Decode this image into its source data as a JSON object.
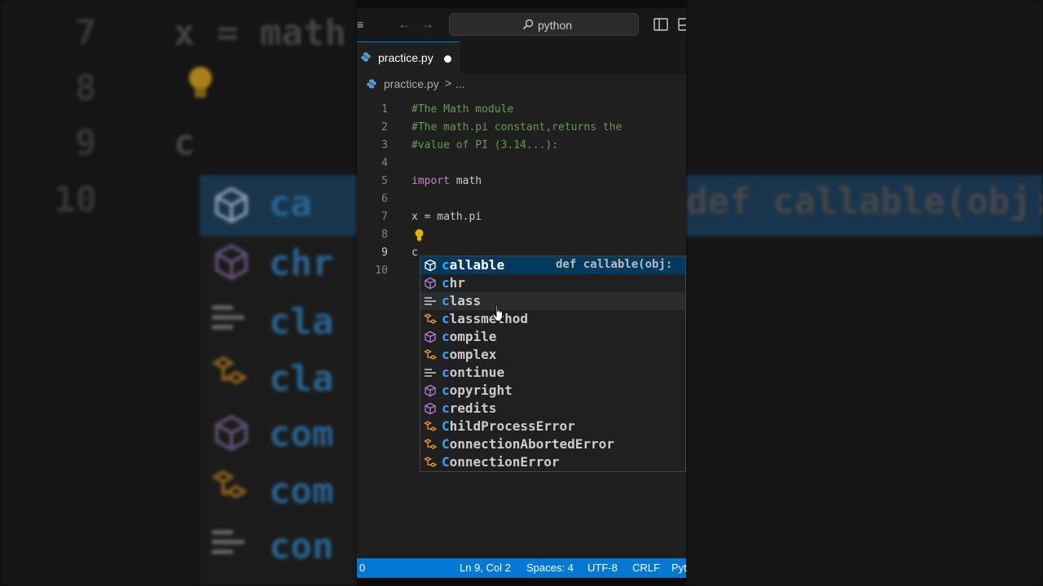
{
  "background": {
    "line_numbers": [
      "7",
      "8",
      "9",
      "10"
    ],
    "code_7": "x = math",
    "code_9": "c",
    "suggest_left": [
      "ca",
      "chr",
      "cla",
      "cla",
      "com",
      "com",
      "con"
    ],
    "suggest_right": "def callable(obj:"
  },
  "titlebar": {
    "search_text": "python"
  },
  "tab": {
    "label": "practice.py"
  },
  "breadcrumb": {
    "file": "practice.py",
    "separator": ">",
    "more": "..."
  },
  "editor": {
    "lines": [
      {
        "n": "1",
        "text": "#The Math module"
      },
      {
        "n": "2",
        "text": "#The math.pi constant,returns the"
      },
      {
        "n": "3",
        "text": "#value of PI (3.14...):"
      },
      {
        "n": "4",
        "text": ""
      },
      {
        "n": "5",
        "kw": "import",
        "rest": " math"
      },
      {
        "n": "6",
        "text": ""
      },
      {
        "n": "7",
        "text": "x = math.pi"
      },
      {
        "n": "8",
        "text": ""
      },
      {
        "n": "9",
        "text": "c"
      },
      {
        "n": "10",
        "text": ""
      }
    ]
  },
  "suggest": {
    "items": [
      {
        "first": "c",
        "rest": "allable",
        "icon": "variable-cube-icon",
        "detail": "def callable(obj:"
      },
      {
        "first": "c",
        "rest": "hr",
        "icon": "variable-cube-icon"
      },
      {
        "first": "c",
        "rest": "lass",
        "icon": "keyword-icon"
      },
      {
        "first": "c",
        "rest": "lassmethod",
        "icon": "class-icon"
      },
      {
        "first": "c",
        "rest": "ompile",
        "icon": "variable-cube-icon"
      },
      {
        "first": "c",
        "rest": "omplex",
        "icon": "class-icon"
      },
      {
        "first": "c",
        "rest": "ontinue",
        "icon": "keyword-icon"
      },
      {
        "first": "c",
        "rest": "opyright",
        "icon": "variable-cube-icon"
      },
      {
        "first": "c",
        "rest": "redits",
        "icon": "variable-cube-icon"
      },
      {
        "first": "C",
        "rest": "hildProcessError",
        "icon": "class-icon"
      },
      {
        "first": "C",
        "rest": "onnectionAbortedError",
        "icon": "class-icon"
      },
      {
        "first": "C",
        "rest": "onnectionError",
        "icon": "class-icon"
      }
    ]
  },
  "statusbar": {
    "left": "0",
    "position": "Ln 9, Col 2",
    "spaces": "Spaces: 4",
    "encoding": "UTF-8",
    "eol": "CRLF",
    "language": "Pyt"
  },
  "colors": {
    "accent": "#0078d4",
    "comment": "#6a9955",
    "keyword": "#c586c0",
    "match_highlight": "#2aaaff",
    "selected_item": "#04395e",
    "class_icon": "#ee9d28",
    "cube_icon": "#b180d7"
  }
}
